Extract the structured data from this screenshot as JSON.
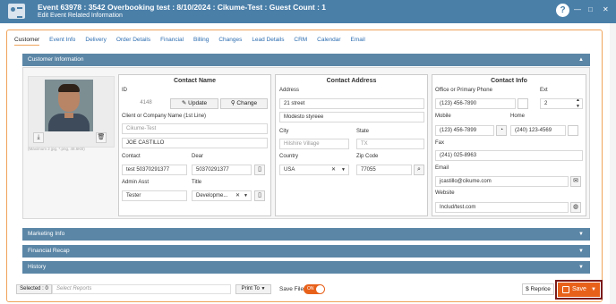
{
  "window": {
    "title": "Event 63978 : 3542 Overbooking test : 8/10/2024 : Cikume-Test : Guest Count : 1",
    "subtitle": "Edit Event Related Information",
    "help": "?",
    "minimize": "—",
    "maximize": "□",
    "close": "✕"
  },
  "tabs": [
    "Customer",
    "Event Info",
    "Delivery",
    "Order Details",
    "Financial",
    "Billing",
    "Changes",
    "Lead Details",
    "CRM",
    "Calendar",
    "Email"
  ],
  "customer_info": {
    "header": "Customer Information",
    "photo_hint": "(Maximum 2 jpg, *.png, 48.6KB)",
    "contact_name": {
      "title": "Contact Name",
      "id_label": "ID",
      "id_value": "4148",
      "update_label": "Update",
      "change_label": "Change",
      "company_label": "Client or Company Name (1st Line)",
      "company_value": "Cikume-Test",
      "name_value": "JOE CASTILLO",
      "contact_label": "Contact",
      "contact_value": "test 50370291377",
      "dear_label": "Dear",
      "dear_value": "50370291377",
      "admin_label": "Admin Asst",
      "admin_value": "Tester",
      "title_label": "Title",
      "title_value": "Developme..."
    },
    "contact_address": {
      "title": "Contact Address",
      "address_label": "Address",
      "address1": "21 street",
      "address2": "Modesto styreee",
      "city_label": "City",
      "city_value": "Hilshire Village",
      "state_label": "State",
      "state_value": "TX",
      "country_label": "Country",
      "country_value": "USA",
      "zip_label": "Zip Code",
      "zip_value": "77055"
    },
    "contact_info": {
      "title": "Contact Info",
      "office_label": "Office or Primary Phone",
      "office_value": "(123) 456-7890",
      "ext_label": "Ext",
      "ext_value": "2",
      "mobile_label": "Mobile",
      "mobile_value": "(123) 456-7899",
      "home_label": "Home",
      "home_value": "(240) 123-4569",
      "fax_label": "Fax",
      "fax_value": "(241) 025-8963",
      "email_label": "Email",
      "email_value": "jcastillo@cikume.com",
      "website_label": "Website",
      "website_value": "Includ/test.com"
    }
  },
  "sections": [
    "Marketing Info",
    "Financial Recap",
    "History"
  ],
  "footer": {
    "selected": "Selected : 0",
    "select_reports": "Select Reports",
    "print_to": "Print To",
    "save_file": "Save File",
    "toggle_state": "ON",
    "reprice": "Reprice",
    "save": "Save"
  },
  "colors": {
    "titlebar": "#4a7fa8",
    "section_bar": "#5b86a6",
    "accent": "#e8611b",
    "tab_link": "#2c6db0"
  }
}
